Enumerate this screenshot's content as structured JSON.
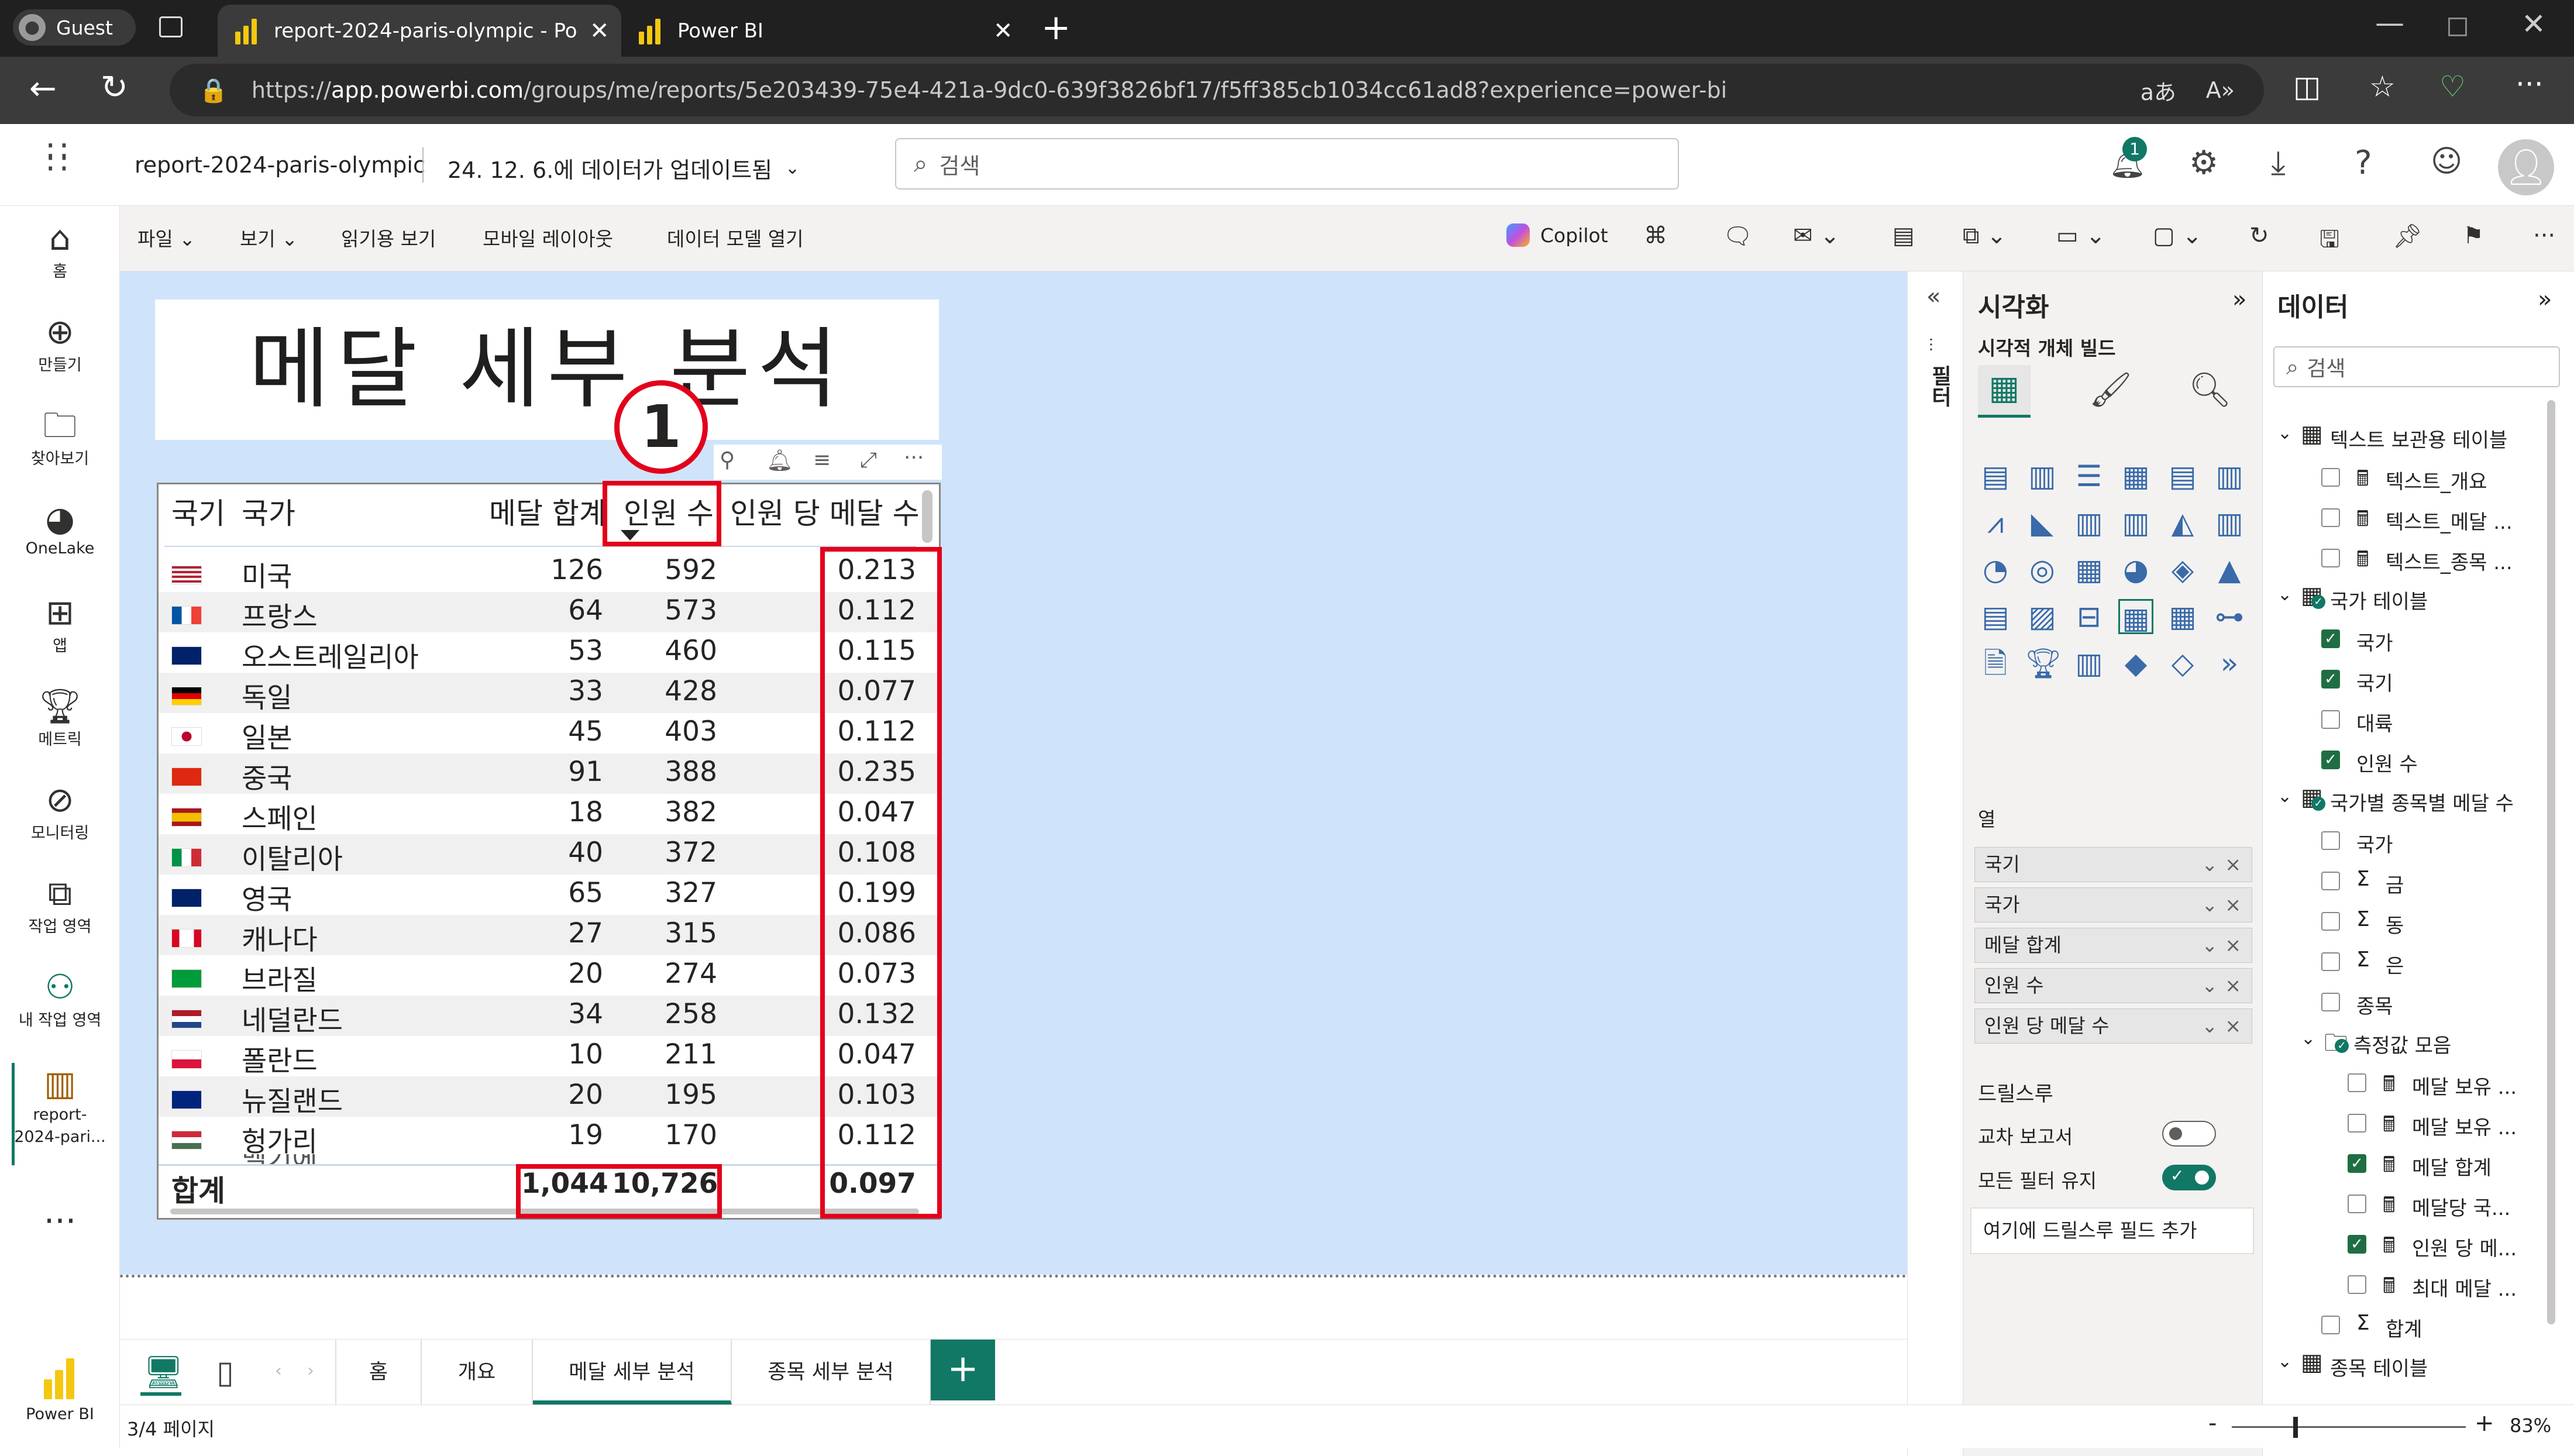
{
  "browser": {
    "profile": "Guest",
    "tabs": [
      {
        "label": "report-2024-paris-olympic - Powe",
        "active": true
      },
      {
        "label": "Power BI",
        "active": false
      }
    ],
    "url": "https://app.powerbi.com/groups/me/reports/5e203439-75e4-421a-9dc0-639f3826bf17/f5ff385cb1034cc61ad8?experience=power-bi",
    "url_host": "app.powerbi.com",
    "url_prefix": "https://",
    "url_path": "/groups/me/reports/5e203439-75e4-421a-9dc0-639f3826bf17/f5ff385cb1034cc61ad8?experience=power-bi",
    "read_aloud": "aあ"
  },
  "header": {
    "report_name": "report-2024-paris-olympic",
    "updated": "24. 12. 6.에 데이터가 업데이트됨",
    "search_placeholder": "검색",
    "notification_count": "1"
  },
  "leftnav": [
    {
      "icon": "home-icon",
      "label": "홈"
    },
    {
      "icon": "create-icon",
      "label": "만들기"
    },
    {
      "icon": "browse-icon",
      "label": "찾아보기"
    },
    {
      "icon": "onelake-icon",
      "label": "OneLake"
    },
    {
      "icon": "apps-icon",
      "label": "앱"
    },
    {
      "icon": "metrics-icon",
      "label": "메트릭"
    },
    {
      "icon": "monitoring-icon",
      "label": "모니터링"
    },
    {
      "icon": "workspaces-icon",
      "label": "작업 영역"
    },
    {
      "icon": "my-workspace-icon",
      "label": "내 작업 영역"
    },
    {
      "icon": "report-icon",
      "label": "report-2024-pari..."
    },
    {
      "icon": "more-icon",
      "label": "..."
    },
    {
      "icon": "powerbi-icon",
      "label": "Power BI"
    }
  ],
  "ribbon": {
    "menus": [
      "파일",
      "보기",
      "읽기용 보기",
      "모바일 레이아웃",
      "데이터 모델 열기"
    ],
    "copilot": "Copilot"
  },
  "report": {
    "title": "메달 세부 분석",
    "callout": "1",
    "columns": [
      "국기",
      "국가",
      "메달 합계",
      "인원 수",
      "인원 당 메달 수"
    ],
    "rows": [
      {
        "flag": "us",
        "country": "미국",
        "medals": "126",
        "people": "592",
        "ratio": "0.213"
      },
      {
        "flag": "fr",
        "country": "프랑스",
        "medals": "64",
        "people": "573",
        "ratio": "0.112"
      },
      {
        "flag": "au",
        "country": "오스트레일리아",
        "medals": "53",
        "people": "460",
        "ratio": "0.115"
      },
      {
        "flag": "de",
        "country": "독일",
        "medals": "33",
        "people": "428",
        "ratio": "0.077"
      },
      {
        "flag": "jp",
        "country": "일본",
        "medals": "45",
        "people": "403",
        "ratio": "0.112"
      },
      {
        "flag": "cn",
        "country": "중국",
        "medals": "91",
        "people": "388",
        "ratio": "0.235"
      },
      {
        "flag": "es",
        "country": "스페인",
        "medals": "18",
        "people": "382",
        "ratio": "0.047"
      },
      {
        "flag": "it",
        "country": "이탈리아",
        "medals": "40",
        "people": "372",
        "ratio": "0.108"
      },
      {
        "flag": "gb",
        "country": "영국",
        "medals": "65",
        "people": "327",
        "ratio": "0.199"
      },
      {
        "flag": "ca",
        "country": "캐나다",
        "medals": "27",
        "people": "315",
        "ratio": "0.086"
      },
      {
        "flag": "br",
        "country": "브라질",
        "medals": "20",
        "people": "274",
        "ratio": "0.073"
      },
      {
        "flag": "nl",
        "country": "네덜란드",
        "medals": "34",
        "people": "258",
        "ratio": "0.132"
      },
      {
        "flag": "pl",
        "country": "폴란드",
        "medals": "10",
        "people": "211",
        "ratio": "0.047"
      },
      {
        "flag": "nz",
        "country": "뉴질랜드",
        "medals": "20",
        "people": "195",
        "ratio": "0.103"
      },
      {
        "flag": "hu",
        "country": "헝가리",
        "medals": "19",
        "people": "170",
        "ratio": "0.112"
      }
    ],
    "total": {
      "label": "합계",
      "medals": "1,044",
      "people": "10,726",
      "ratio": "0.097"
    }
  },
  "filters_label": "필터",
  "viz": {
    "title": "시각화",
    "build_label": "시각적 개체 빌드",
    "columns_label": "열",
    "wells": [
      "국기",
      "국가",
      "메달 합계",
      "인원 수",
      "인원 당 메달 수"
    ],
    "drill_label": "드릴스루",
    "cross_report": "교차 보고서",
    "keep_filters": "모든 필터 유지",
    "drill_add": "여기에 드릴스루 필드 추가",
    "cross_report_on": false,
    "keep_filters_on": true
  },
  "data": {
    "title": "데이터",
    "search_placeholder": "검색",
    "tree": [
      {
        "level": 0,
        "type": "table",
        "label": "텍스트 보관용 테이블",
        "expanded": true
      },
      {
        "level": 1,
        "type": "measure",
        "label": "텍스트_개요",
        "checked": false
      },
      {
        "level": 1,
        "type": "measure",
        "label": "텍스트_메달 ...",
        "checked": false
      },
      {
        "level": 1,
        "type": "measure",
        "label": "텍스트_종목 ...",
        "checked": false
      },
      {
        "level": 0,
        "type": "table-used",
        "label": "국가 테이블",
        "expanded": true
      },
      {
        "level": 1,
        "type": "field",
        "label": "국가",
        "checked": true
      },
      {
        "level": 1,
        "type": "field",
        "label": "국기",
        "checked": true
      },
      {
        "level": 1,
        "type": "field",
        "label": "대륙",
        "checked": false
      },
      {
        "level": 1,
        "type": "field",
        "label": "인원 수",
        "checked": true
      },
      {
        "level": 0,
        "type": "table-used",
        "label": "국가별 종목별 메달 수",
        "expanded": true
      },
      {
        "level": 1,
        "type": "field",
        "label": "국가",
        "checked": false
      },
      {
        "level": 1,
        "type": "sum",
        "label": "금",
        "checked": false
      },
      {
        "level": 1,
        "type": "sum",
        "label": "동",
        "checked": false
      },
      {
        "level": 1,
        "type": "sum",
        "label": "은",
        "checked": false
      },
      {
        "level": 1,
        "type": "field",
        "label": "종목",
        "checked": false
      },
      {
        "level": 1,
        "type": "folder",
        "label": "측정값 모음",
        "expanded": true
      },
      {
        "level": 2,
        "type": "measure",
        "label": "메달 보유 ...",
        "checked": false
      },
      {
        "level": 2,
        "type": "measure",
        "label": "메달 보유 ...",
        "checked": false
      },
      {
        "level": 2,
        "type": "measure",
        "label": "메달 합계",
        "checked": true
      },
      {
        "level": 2,
        "type": "measure",
        "label": "메달당 국...",
        "checked": false
      },
      {
        "level": 2,
        "type": "measure",
        "label": "인원 당 메...",
        "checked": true
      },
      {
        "level": 2,
        "type": "measure",
        "label": "최대 메달 ...",
        "checked": false
      },
      {
        "level": 1,
        "type": "sum",
        "label": "합계",
        "checked": false
      },
      {
        "level": 0,
        "type": "table",
        "label": "종목 테이블",
        "expanded": true
      }
    ]
  },
  "pagetabs": [
    "홈",
    "개요",
    "메달 세부 분석",
    "종목 세부 분석"
  ],
  "active_page": "메달 세부 분석",
  "status": {
    "page": "3/4 페이지",
    "zoom": "83%"
  },
  "colors": {
    "accent": "#117865",
    "highlight": "#e3001b",
    "canvas": "#cfe4fa"
  }
}
